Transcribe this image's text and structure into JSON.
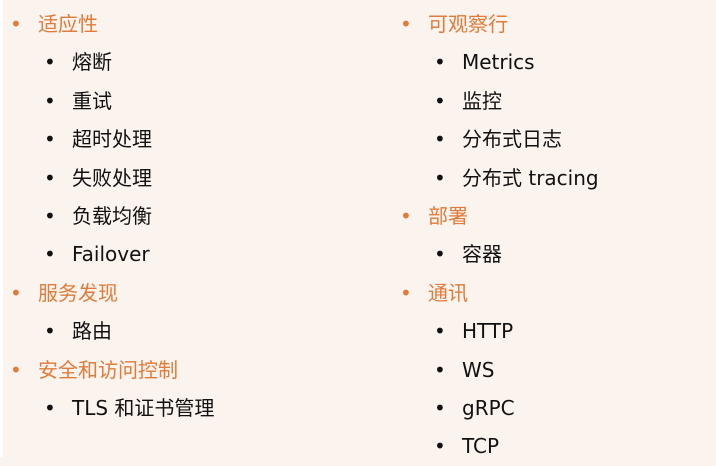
{
  "colors": {
    "heading": "#e07b39",
    "item": "#111111",
    "background": "#fbf3ee"
  },
  "left_column": [
    {
      "heading": "适应性",
      "items": [
        "熔断",
        "重试",
        "超时处理",
        "失败处理",
        "负载均衡",
        "Failover"
      ]
    },
    {
      "heading": "服务发现",
      "items": [
        "路由"
      ]
    },
    {
      "heading": "安全和访问控制",
      "items": [
        "TLS 和证书管理"
      ]
    }
  ],
  "right_column": [
    {
      "heading": "可观察行",
      "items": [
        "Metrics",
        "监控",
        "分布式日志",
        "分布式 tracing"
      ]
    },
    {
      "heading": "部署",
      "items": [
        "容器"
      ]
    },
    {
      "heading": "通讯",
      "items": [
        "HTTP",
        "WS",
        "gRPC",
        "TCP"
      ]
    }
  ]
}
